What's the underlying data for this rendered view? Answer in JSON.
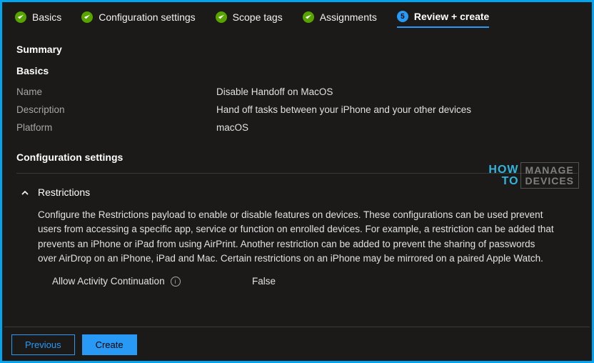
{
  "tabs": {
    "basics": "Basics",
    "config": "Configuration settings",
    "scope": "Scope tags",
    "assign": "Assignments",
    "review": "Review + create",
    "review_step": "5"
  },
  "summary_title": "Summary",
  "basics": {
    "title": "Basics",
    "name_label": "Name",
    "name_value": "Disable Handoff on MacOS",
    "desc_label": "Description",
    "desc_value": "Hand off tasks between your iPhone and your other devices",
    "platform_label": "Platform",
    "platform_value": "macOS"
  },
  "config": {
    "title": "Configuration settings",
    "restrictions_title": "Restrictions",
    "restrictions_body": "Configure the Restrictions payload to enable or disable features on devices. These configurations can be used prevent users from accessing a specific app, service or function on enrolled devices. For example, a restriction can be added that prevents an iPhone or iPad from using AirPrint. Another restriction can be added to prevent the sharing of passwords over AirDrop on an iPhone, iPad and Mac. Certain restrictions on an iPhone may be mirrored on a paired Apple Watch.",
    "allow_label": "Allow Activity Continuation",
    "allow_value": "False"
  },
  "footer": {
    "previous": "Previous",
    "create": "Create"
  },
  "watermark": {
    "how": "HOW",
    "to": "TO",
    "line1": "MANAGE",
    "line2": "DEVICES"
  }
}
